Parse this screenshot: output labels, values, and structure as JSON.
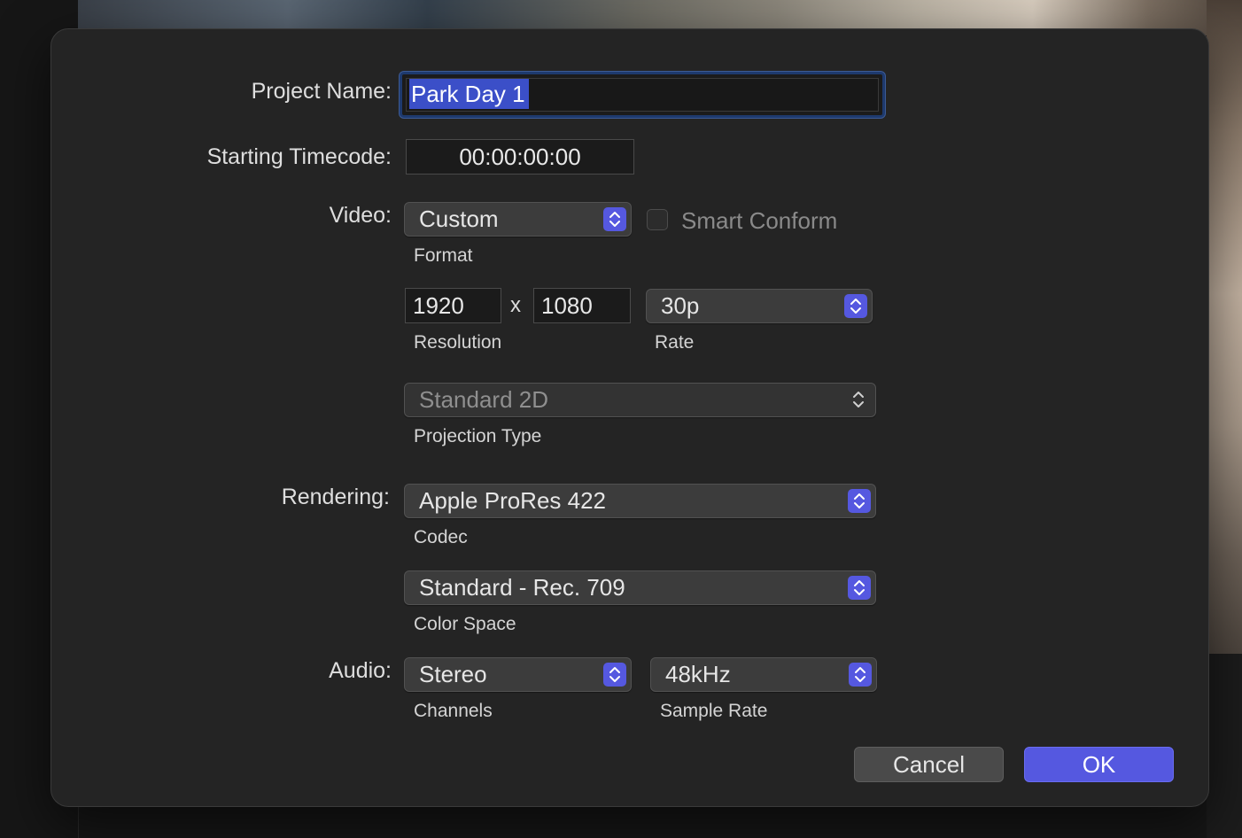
{
  "dialog": {
    "project_name": {
      "label": "Project Name:",
      "value": "Park Day 1"
    },
    "starting_timecode": {
      "label": "Starting Timecode:",
      "value": "00:00:00:00"
    },
    "video": {
      "label": "Video:",
      "format": {
        "value": "Custom",
        "caption": "Format"
      },
      "smart_conform": {
        "label": "Smart Conform",
        "checked": false,
        "enabled": false
      },
      "resolution": {
        "width": "1920",
        "separator": "x",
        "height": "1080",
        "caption": "Resolution"
      },
      "rate": {
        "value": "30p",
        "caption": "Rate"
      },
      "projection": {
        "value": "Standard 2D",
        "caption": "Projection Type",
        "enabled": false
      }
    },
    "rendering": {
      "label": "Rendering:",
      "codec": {
        "value": "Apple ProRes 422",
        "caption": "Codec"
      },
      "color_space": {
        "value": "Standard - Rec. 709",
        "caption": "Color Space"
      }
    },
    "audio": {
      "label": "Audio:",
      "channels": {
        "value": "Stereo",
        "caption": "Channels"
      },
      "sample_rate": {
        "value": "48kHz",
        "caption": "Sample Rate"
      }
    },
    "buttons": {
      "cancel": "Cancel",
      "ok": "OK"
    }
  },
  "colors": {
    "accent": "#5558e0",
    "selection": "#3b4fc8",
    "dialog_bg": "#242424"
  },
  "icons": {
    "popup_stepper": "chevron-up-down-icon"
  }
}
